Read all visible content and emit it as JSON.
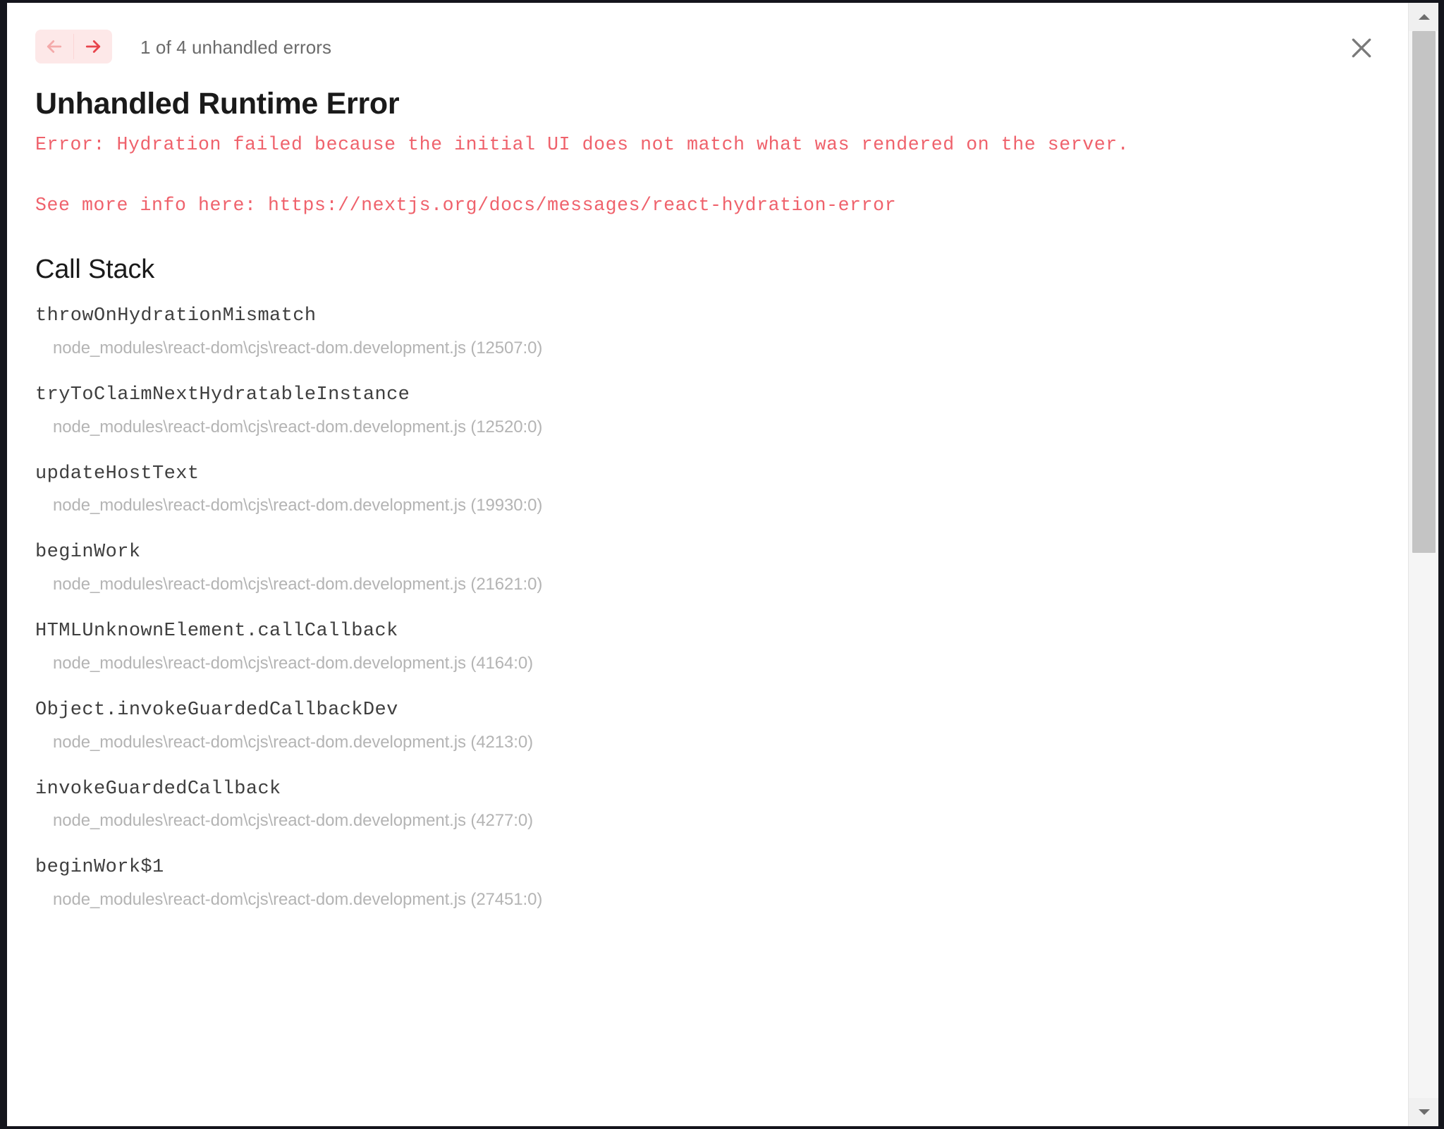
{
  "window": {
    "background_color": "#ffffff",
    "frame_color": "#14151c"
  },
  "header": {
    "prev_icon": "arrow-left-icon",
    "next_icon": "arrow-right-icon",
    "prev_enabled": false,
    "next_enabled": true,
    "error_count_label": "1 of 4 unhandled errors",
    "close_icon": "close-icon",
    "nav_background_color": "#fde8e8",
    "next_arrow_color": "#e8444c",
    "prev_arrow_color": "#f4aaaa"
  },
  "error": {
    "title": "Unhandled Runtime Error",
    "message": "Error: Hydration failed because the initial UI does not match what was rendered on the server.",
    "more_info": "See more info here: https://nextjs.org/docs/messages/react-hydration-error",
    "message_color": "#ef626c"
  },
  "call_stack": {
    "title": "Call Stack",
    "frames": [
      {
        "function": "throwOnHydrationMismatch",
        "location": "node_modules\\react-dom\\cjs\\react-dom.development.js (12507:0)"
      },
      {
        "function": "tryToClaimNextHydratableInstance",
        "location": "node_modules\\react-dom\\cjs\\react-dom.development.js (12520:0)"
      },
      {
        "function": "updateHostText",
        "location": "node_modules\\react-dom\\cjs\\react-dom.development.js (19930:0)"
      },
      {
        "function": "beginWork",
        "location": "node_modules\\react-dom\\cjs\\react-dom.development.js (21621:0)"
      },
      {
        "function": "HTMLUnknownElement.callCallback",
        "location": "node_modules\\react-dom\\cjs\\react-dom.development.js (4164:0)"
      },
      {
        "function": "Object.invokeGuardedCallbackDev",
        "location": "node_modules\\react-dom\\cjs\\react-dom.development.js (4213:0)"
      },
      {
        "function": "invokeGuardedCallback",
        "location": "node_modules\\react-dom\\cjs\\react-dom.development.js (4277:0)"
      },
      {
        "function": "beginWork$1",
        "location": "node_modules\\react-dom\\cjs\\react-dom.development.js (27451:0)"
      }
    ]
  },
  "scrollbar": {
    "up_icon": "scroll-up-arrow-icon",
    "down_icon": "scroll-down-arrow-icon",
    "thumb_color": "#c4c4c4",
    "track_color": "#f5f5f5"
  }
}
